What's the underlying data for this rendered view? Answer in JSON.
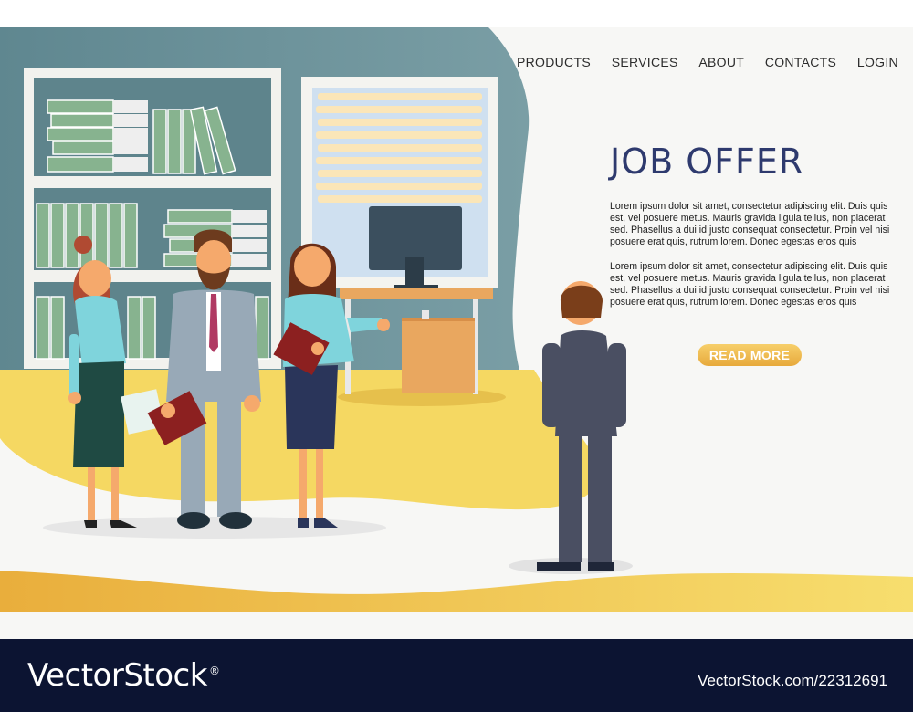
{
  "nav": {
    "items": [
      {
        "label": "PRODUCTS"
      },
      {
        "label": "SERVICES"
      },
      {
        "label": "ABOUT"
      },
      {
        "label": "CONTACTS"
      },
      {
        "label": "LOGIN"
      }
    ]
  },
  "hero": {
    "title": "JOB OFFER",
    "paragraphs": [
      "Lorem ipsum dolor sit amet, consectetur adipiscing elit. Duis quis est, vel posuere metus. Mauris gravida ligula tellus, non placerat sed. Phasellus a dui id justo consequat consectetur. Proin vel nisi posuere erat quis, rutrum lorem. Donec egestas eros quis",
      "Lorem ipsum dolor sit amet, consectetur adipiscing elit. Duis quis est, vel posuere metus. Mauris gravida ligula tellus, non placerat sed. Phasellus a dui id justo consequat consectetur. Proin vel nisi posuere erat quis, rutrum lorem. Donec egestas eros quis"
    ],
    "read_more_label": "READ MORE"
  },
  "footer": {
    "brand": "VectorStock",
    "registered_mark": "®",
    "image_id": "VectorStock.com/22312691"
  },
  "colors": {
    "wall": "#6b8e95",
    "floor_yellow": "#f5d862",
    "title_navy": "#2e3a6e",
    "button_gold": "#e9ad3e",
    "footer_navy": "#0c1432"
  }
}
